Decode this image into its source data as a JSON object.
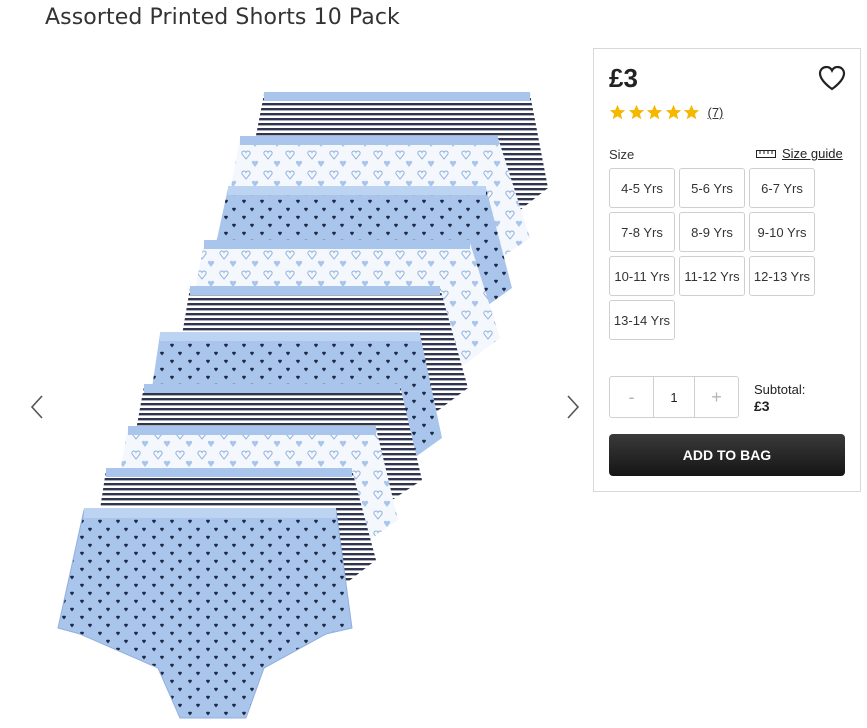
{
  "product": {
    "title": "Assorted Printed Shorts 10 Pack",
    "price": "£3",
    "review_count": "(7)",
    "rating_stars": 5,
    "size_label": "Size",
    "size_guide_label": "Size guide",
    "sizes": [
      "4-5 Yrs",
      "5-6 Yrs",
      "6-7 Yrs",
      "7-8 Yrs",
      "8-9 Yrs",
      "9-10 Yrs",
      "10-11 Yrs",
      "11-12 Yrs",
      "12-13 Yrs",
      "13-14 Yrs"
    ],
    "quantity": "1",
    "minus_label": "-",
    "plus_label": "+",
    "subtotal_label": "Subtotal:",
    "subtotal_value": "£3",
    "add_to_bag_label": "ADD TO BAG"
  },
  "colors": {
    "star": "#f5b800",
    "button_dark": "#222222",
    "shorts_blue": "#a9c5ec",
    "stripe_navy": "#2f3550"
  },
  "icons": {
    "wishlist": "heart-outline-icon",
    "size_guide": "ruler-icon",
    "prev": "chevron-left-icon",
    "next": "chevron-right-icon",
    "rating": "star-icon"
  }
}
